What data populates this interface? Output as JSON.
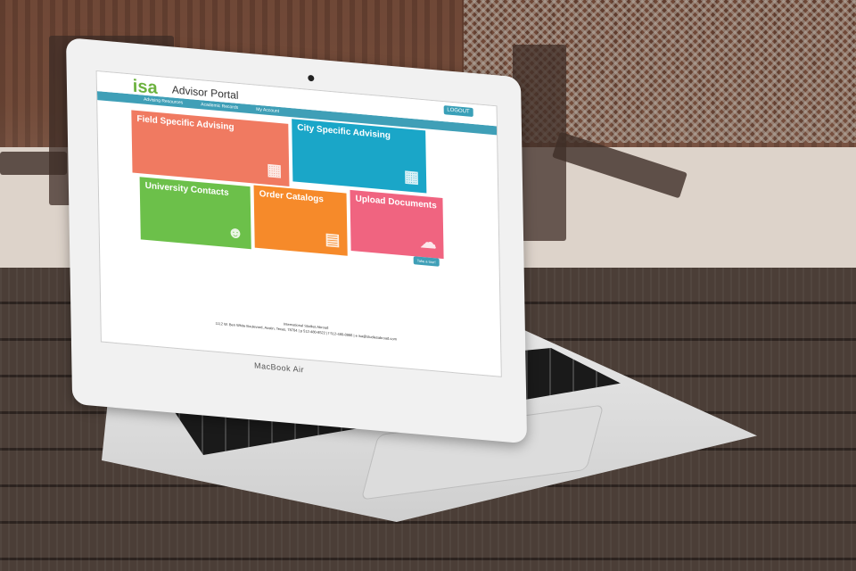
{
  "laptop": {
    "brand_text": "MacBook Air"
  },
  "portal": {
    "logo_text": "isa",
    "title": "Advisor Portal",
    "logout_label": "LOGOUT",
    "nav": [
      "Advising Resources",
      "Academic Records",
      "My Account"
    ],
    "tiles": [
      {
        "label": "Field Specific Advising",
        "color": "#f07a61"
      },
      {
        "label": "City Specific Advising",
        "color": "#1aa6c8"
      },
      {
        "label": "University Contacts",
        "color": "#6cc04a"
      },
      {
        "label": "Order Catalogs",
        "color": "#f68a2a"
      },
      {
        "label": "Upload Documents",
        "color": "#f06480"
      }
    ],
    "tour_button": "Take a tour!",
    "footer_org": "International Studies Abroad",
    "footer_address": "1112 W. Ben White Boulevard, Austin, Texas, 78704 | p 512-480-8522 | f 512-480-8866 | e isa@studiesabroad.com"
  }
}
